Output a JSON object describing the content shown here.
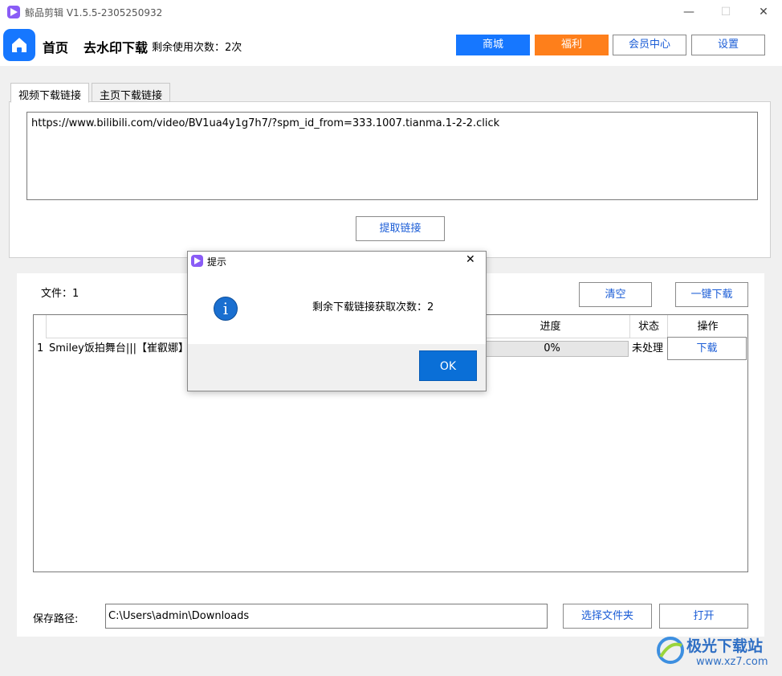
{
  "window": {
    "title": "鲸品剪辑 V1.5.5-2305250932",
    "minimize": "—",
    "maximize": "☐",
    "close": "✕"
  },
  "header": {
    "nav_home": "首页",
    "nav_download": "去水印下载",
    "remaining": "剩余使用次数：2次",
    "buttons": {
      "shop": "商城",
      "welfare": "福利",
      "member": "会员中心",
      "settings": "设置"
    }
  },
  "colors": {
    "primary": "#1677ff",
    "orange": "#fe7f1b",
    "link": "#1a5cd6"
  },
  "tabs": [
    {
      "label": "视频下载链接",
      "active": true
    },
    {
      "label": "主页下载链接",
      "active": false
    }
  ],
  "link_input": {
    "value": "https://www.bilibili.com/video/BV1ua4y1g7h7/?spm_id_from=333.1007.tianma.1-2-2.click"
  },
  "extract_button": "提取链接",
  "files": {
    "count_label": "文件：1",
    "clear_button": "清空",
    "download_all_button": "一键下载"
  },
  "table": {
    "headers": {
      "progress": "进度",
      "status": "状态",
      "action": "操作"
    },
    "rows": [
      {
        "index": "1",
        "name": "Smiley饭拍舞台|||【崔叡娜】2",
        "progress": "0%",
        "progress_value": 0,
        "status": "未处理",
        "action": "下载"
      }
    ]
  },
  "save": {
    "label": "保存路径:",
    "path": "C:\\Users\\admin\\Downloads",
    "choose_button": "选择文件夹",
    "open_button": "打开"
  },
  "dialog": {
    "title": "提示",
    "close": "✕",
    "icon": "info-icon",
    "message": "剩余下载链接获取次数：2",
    "ok": "OK"
  },
  "watermark": {
    "brand": "极光下载站",
    "url": "www.xz7.com"
  }
}
